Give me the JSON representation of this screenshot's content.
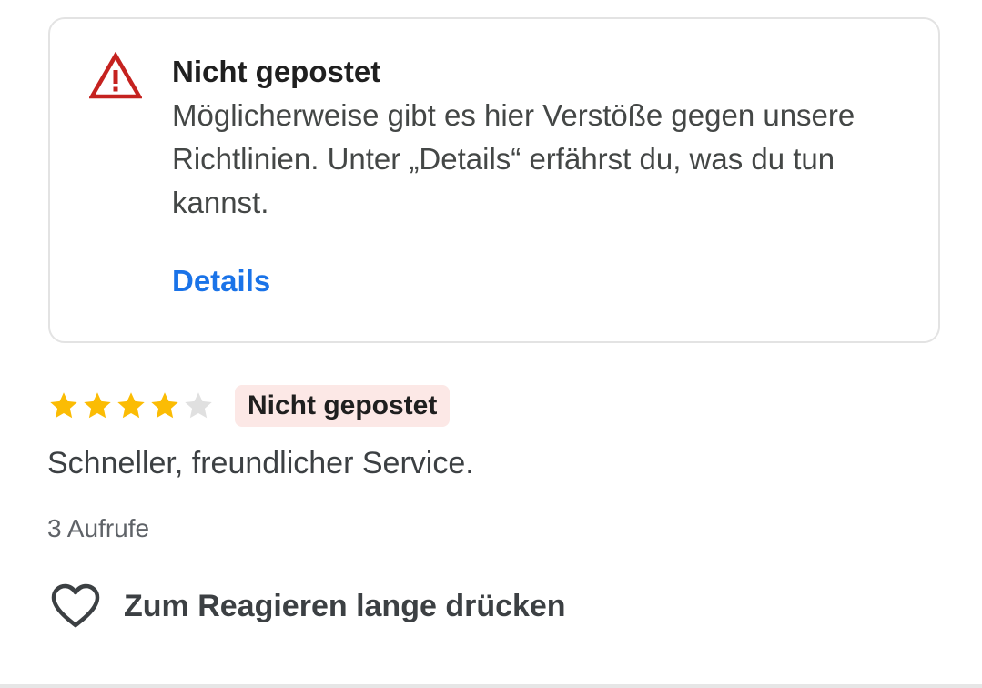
{
  "alert": {
    "title": "Nicht gepostet",
    "body": "Möglicherweise gibt es hier Verstöße gegen unsere Richtlinien. Unter „Details“ erfährst du, was du tun kannst.",
    "details_label": "Details",
    "icon": "warning-triangle-icon",
    "icon_color": "#c5221f",
    "link_color": "#1a73e8"
  },
  "review": {
    "rating": 4,
    "max_rating": 5,
    "star_filled_color": "#fbbc04",
    "star_empty_color": "#e0e0e0",
    "status_badge": "Nicht gepostet",
    "status_badge_color": "#fce8e6",
    "text": "Schneller, freundlicher Service.",
    "views": "3 Aufrufe"
  },
  "reaction": {
    "label": "Zum Reagieren lange drücken",
    "icon": "heart-outline-icon"
  }
}
